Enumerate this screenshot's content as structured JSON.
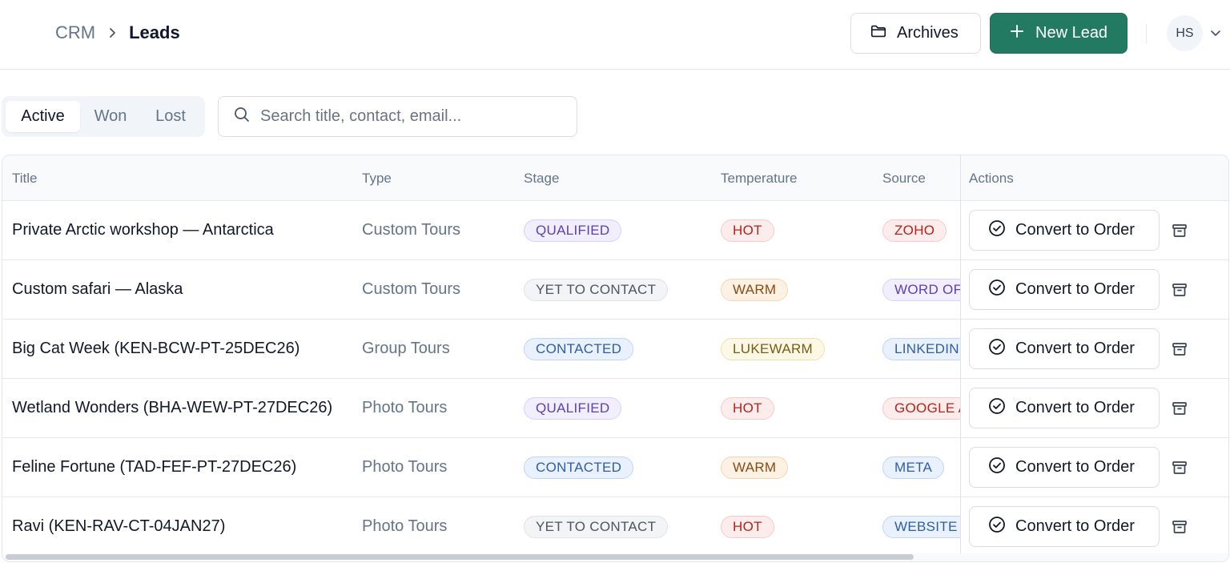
{
  "breadcrumb": {
    "root": "CRM",
    "current": "Leads"
  },
  "header": {
    "archives_label": "Archives",
    "new_lead_label": "New Lead",
    "avatar_initials": "HS"
  },
  "filters": {
    "tabs": [
      {
        "label": "Active",
        "selected": true
      },
      {
        "label": "Won",
        "selected": false
      },
      {
        "label": "Lost",
        "selected": false
      }
    ],
    "search_placeholder": "Search title, contact, email..."
  },
  "table": {
    "columns": [
      "Title",
      "Type",
      "Stage",
      "Temperature",
      "Source",
      "Actions"
    ],
    "convert_label": "Convert to Order",
    "rows": [
      {
        "title": "Private Arctic workshop — Antarctica",
        "type": "Custom Tours",
        "stage": "QUALIFIED",
        "temperature": "HOT",
        "source": "ZOHO"
      },
      {
        "title": "Custom safari — Alaska",
        "type": "Custom Tours",
        "stage": "YET TO CONTACT",
        "temperature": "WARM",
        "source": "WORD OF"
      },
      {
        "title": "Big Cat Week (KEN-BCW-PT-25DEC26)",
        "type": "Group Tours",
        "stage": "CONTACTED",
        "temperature": "LUKEWARM",
        "source": "LINKEDIN"
      },
      {
        "title": "Wetland Wonders (BHA-WEW-PT-27DEC26)",
        "type": "Photo Tours",
        "stage": "QUALIFIED",
        "temperature": "HOT",
        "source": "GOOGLE A"
      },
      {
        "title": "Feline Fortune (TAD-FEF-PT-27DEC26)",
        "type": "Photo Tours",
        "stage": "CONTACTED",
        "temperature": "WARM",
        "source": "META"
      },
      {
        "title": "Ravi (KEN-RAV-CT-04JAN27)",
        "type": "Photo Tours",
        "stage": "YET TO CONTACT",
        "temperature": "HOT",
        "source": "WEBSITE"
      }
    ]
  },
  "colors": {
    "primary": "#237a63",
    "qualified": {
      "bg": "#f1eefe",
      "border": "#d9d0fb",
      "text": "#5b3fb5"
    },
    "yet_to_contact": {
      "bg": "#f3f4f6",
      "border": "#dfe2e6",
      "text": "#4b5563"
    },
    "contacted": {
      "bg": "#e8f1fd",
      "border": "#bfd7f6",
      "text": "#2f5ea6"
    },
    "hot": {
      "bg": "#fdecec",
      "border": "#f6caca",
      "text": "#b42318"
    },
    "warm": {
      "bg": "#fdf1e4",
      "border": "#f4d6b3",
      "text": "#8a4a12"
    },
    "lukewarm": {
      "bg": "#fdf8e6",
      "border": "#efe1ad",
      "text": "#7a5b10"
    },
    "source_zoho": {
      "bg": "#fdecec",
      "border": "#f6caca",
      "text": "#b42318"
    },
    "source_wordof": {
      "bg": "#f1eefe",
      "border": "#d9d0fb",
      "text": "#5b3fb5"
    },
    "source_blue": {
      "bg": "#e8f1fd",
      "border": "#bfd7f6",
      "text": "#2f5ea6"
    }
  }
}
